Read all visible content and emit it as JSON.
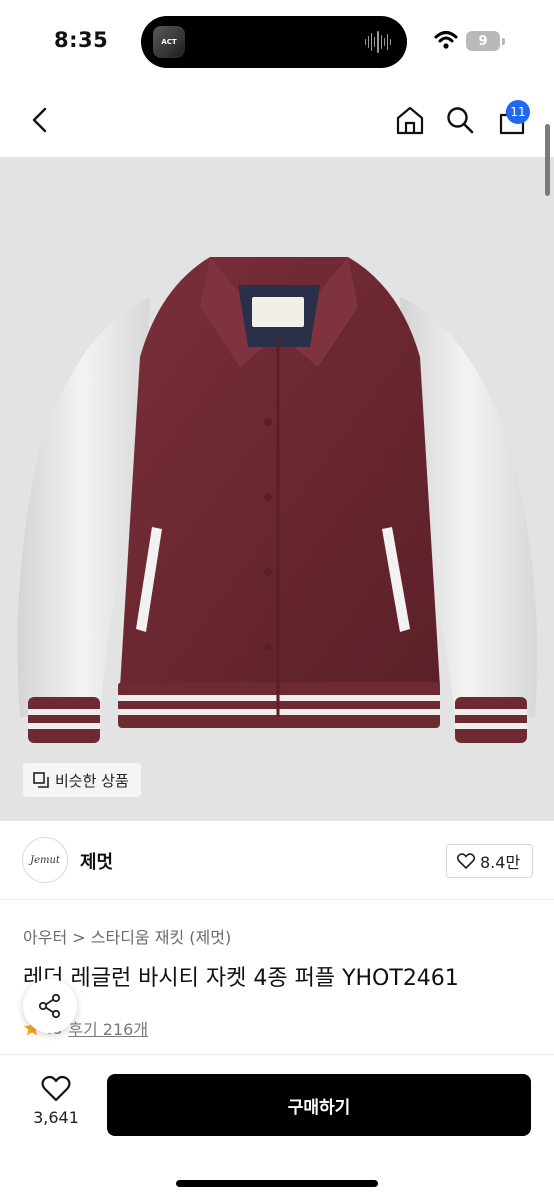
{
  "status_bar": {
    "time": "8:35",
    "battery": "9",
    "album_badge": "ACT",
    "icons": [
      "wifi-icon",
      "battery-icon",
      "waveform-icon"
    ]
  },
  "nav": {
    "icons": [
      "back-icon",
      "home-icon",
      "search-icon",
      "cart-icon"
    ],
    "cart_count": "11"
  },
  "hero": {
    "image_subject": "burgundy varsity jacket with white leather sleeves",
    "similar_label": "비슷한 상품"
  },
  "brand": {
    "logo_text": "Jemut",
    "name": "제멋",
    "likes": "8.4만"
  },
  "product": {
    "breadcrumb_category": "아우터",
    "breadcrumb_sep": ">",
    "breadcrumb_sub": "스타디움 재킷 (제멋)",
    "title": "레더 레글런 바시티 자켓 4종 퍼플 YHOT2461",
    "rating": ".8",
    "reviews": "후기 216개"
  },
  "bottom": {
    "like_count": "3,641",
    "buy_label": "구매하기"
  },
  "colors": {
    "accent_badge": "#1f6af0",
    "jacket_body": "#6e2a33",
    "star": "#f5a623",
    "buy_button": "#000000"
  }
}
